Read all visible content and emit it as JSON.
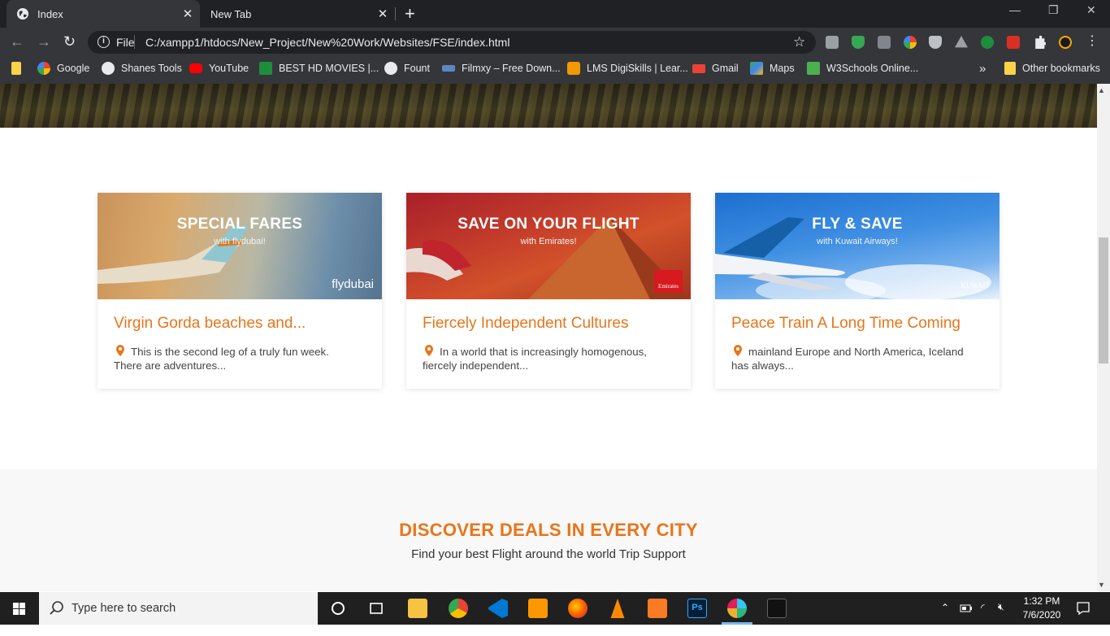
{
  "browser": {
    "tabs": [
      {
        "title": "Index",
        "active": true
      },
      {
        "title": "New Tab",
        "active": false
      }
    ],
    "new_tab_symbol": "+",
    "close_symbol": "✕",
    "url_scheme": "File",
    "url": "C:/xampp1/htdocs/New_Project/New%20Work/Websites/FSE/index.html",
    "bookmarks": [
      {
        "label": "Google",
        "icon": "google-icon"
      },
      {
        "label": "Shanes Tools",
        "icon": "globe-icon"
      },
      {
        "label": "YouTube",
        "icon": "youtube-icon"
      },
      {
        "label": "BEST HD MOVIES |...",
        "icon": "m-icon"
      },
      {
        "label": "Fount",
        "icon": "globe-icon"
      },
      {
        "label": "Filmxy – Free Down...",
        "icon": "filmxy-icon"
      },
      {
        "label": "LMS DigiSkills | Lear...",
        "icon": "digiskills-icon"
      },
      {
        "label": "Gmail",
        "icon": "gmail-icon"
      },
      {
        "label": "Maps",
        "icon": "maps-icon"
      },
      {
        "label": "W3Schools Online...",
        "icon": "w3schools-icon"
      }
    ],
    "overflow_symbol": "»",
    "other_bookmarks": "Other bookmarks"
  },
  "cards": [
    {
      "image_title": "SPECIAL FARES",
      "image_subtitle": "with flydubai!",
      "brand": "flydubai",
      "title": "Virgin Gorda beaches and...",
      "description": "This is the second leg of a truly fun week. There are adventures..."
    },
    {
      "image_title": "SAVE ON YOUR FLIGHT",
      "image_subtitle": "with Emirates!",
      "brand": "Emirates",
      "title": "Fiercely Independent Cultures",
      "description": "In a world that is increasingly homogenous, fiercely independent..."
    },
    {
      "image_title": "FLY & SAVE",
      "image_subtitle": "with Kuwait Airways!",
      "brand": "KUWAIT",
      "title": "Peace Train A Long Time Coming",
      "description": "mainland Europe and North America, Iceland has always..."
    }
  ],
  "deals": {
    "title": "DISCOVER DEALS IN EVERY CITY",
    "subtitle": "Find your best Flight around the world Trip Support"
  },
  "taskbar": {
    "search_placeholder": "Type here to search",
    "time": "1:32 PM",
    "date": "7/6/2020"
  },
  "colors": {
    "accent": "#e8751a",
    "chrome_dark": "#202124",
    "chrome_toolbar": "#35363a",
    "taskbar": "#202020"
  }
}
